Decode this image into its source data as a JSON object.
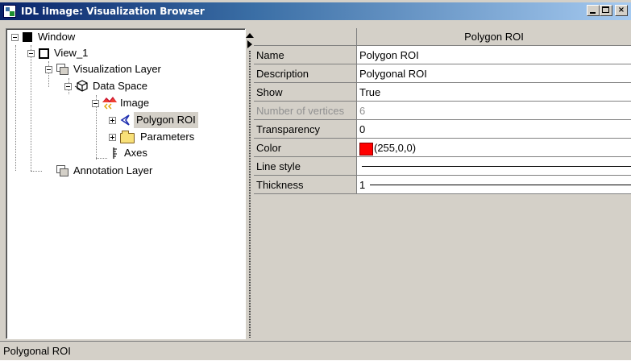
{
  "window": {
    "title": "IDL iImage: Visualization Browser",
    "controls": {
      "minimize": "minimize-icon",
      "maximize": "maximize-icon",
      "close": "×"
    }
  },
  "tree": {
    "nodes": [
      {
        "label": "Window",
        "icon": "window-icon",
        "expanded": true
      },
      {
        "label": "View_1",
        "icon": "view-icon",
        "expanded": true
      },
      {
        "label": "Visualization Layer",
        "icon": "layer-icon",
        "expanded": true
      },
      {
        "label": "Data Space",
        "icon": "dataspace-icon",
        "expanded": true
      },
      {
        "label": "Image",
        "icon": "image-icon",
        "expanded": true
      },
      {
        "label": "Polygon ROI",
        "icon": "roi-icon",
        "expanded": false,
        "selected": true
      },
      {
        "label": "Parameters",
        "icon": "folder-icon",
        "expanded": false
      },
      {
        "label": "Axes",
        "icon": "axes-icon"
      },
      {
        "label": "Annotation Layer",
        "icon": "layer-icon"
      }
    ]
  },
  "properties": {
    "header": "Polygon ROI",
    "rows": [
      {
        "name": "Name",
        "value": "Polygon ROI"
      },
      {
        "name": "Description",
        "value": "Polygonal ROI"
      },
      {
        "name": "Show",
        "value": "True"
      },
      {
        "name": "Number of vertices",
        "value": "6",
        "disabled": true
      },
      {
        "name": "Transparency",
        "value": "0"
      },
      {
        "name": "Color",
        "value": "(255,0,0)",
        "swatch": "#ff0000"
      },
      {
        "name": "Line style",
        "value": ""
      },
      {
        "name": "Thickness",
        "value": "1"
      }
    ]
  },
  "status": {
    "text": "Polygonal ROI"
  },
  "colors": {
    "title_start": "#0a246a",
    "title_end": "#a6caf0",
    "face": "#d4d0c8",
    "roi_color": "#ff0000"
  }
}
